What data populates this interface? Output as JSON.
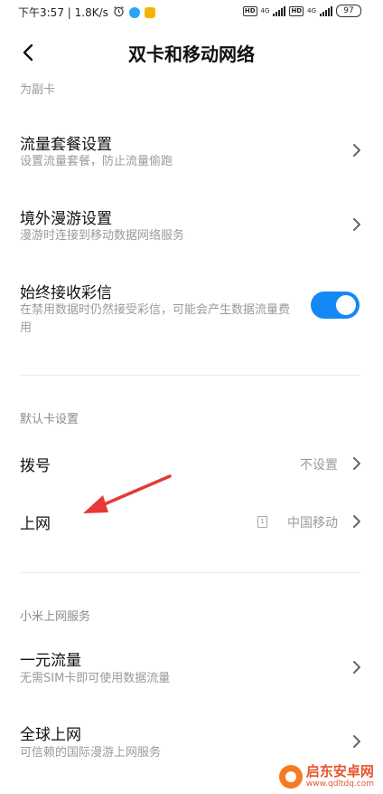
{
  "status_bar": {
    "time_speed": "下午3:57 | 1.8K/s",
    "hd": "HD",
    "net1": "4G",
    "net2": "4G",
    "battery": "97"
  },
  "header": {
    "title": "双卡和移动网络"
  },
  "faded_label": "为副卡",
  "rows": {
    "data_plan": {
      "title": "流量套餐设置",
      "sub": "设置流量套餐，防止流量偷跑"
    },
    "roaming": {
      "title": "境外漫游设置",
      "sub": "漫游时连接到移动数据网络服务"
    },
    "mms": {
      "title": "始终接收彩信",
      "sub": "在禁用数据时仍然接受彩信，可能会产生数据流量费用",
      "enabled": true
    },
    "dial": {
      "title": "拨号",
      "value": "不设置"
    },
    "internet": {
      "title": "上网",
      "value": "中国移动",
      "sim": "1"
    },
    "one_yuan": {
      "title": "一元流量",
      "sub": "无需SIM卡即可使用数据流量"
    },
    "global": {
      "title": "全球上网",
      "sub": "可信赖的国际漫游上网服务"
    }
  },
  "sections": {
    "default_card": "默认卡设置",
    "mi_service": "小米上网服务"
  },
  "watermark": {
    "name": "启东安卓网",
    "url": "www.qdltdq.com"
  },
  "colors": {
    "accent": "#1489f5",
    "arrow": "#e53935"
  }
}
